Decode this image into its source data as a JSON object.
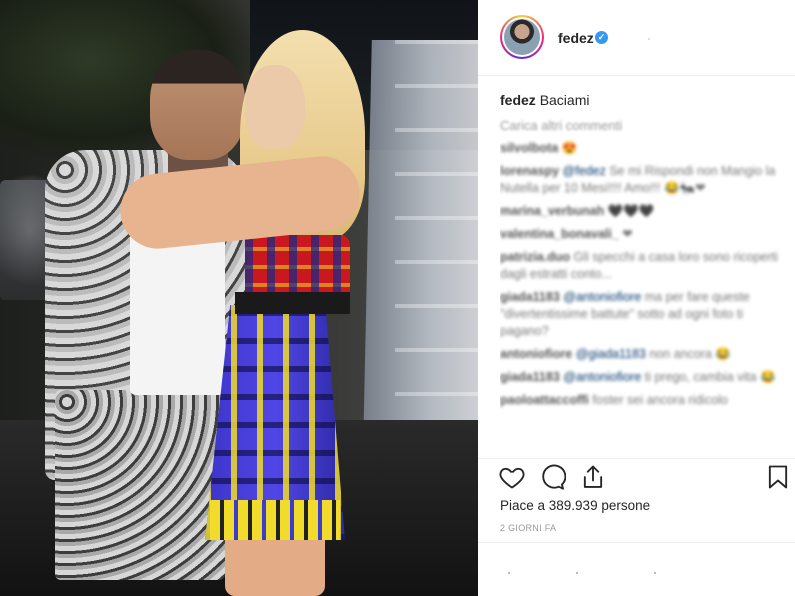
{
  "post": {
    "username": "fedez",
    "verified_mark": "✓",
    "caption_user": "fedez",
    "caption_text": "Baciami",
    "load_more": "Carica altri commenti",
    "likes_text": "Piace a 389.939 persone",
    "date": "2 GIORNI FA"
  },
  "comments": [
    {
      "user": "silvolbota",
      "text": "😍"
    },
    {
      "user": "lorenaspy",
      "mention": "@fedez",
      "text": "Se mi Rispondi non Mangio la Nutella per 10 Mesi!!!! Amo!!! 😂🐜❤"
    },
    {
      "user": "marina_verbunah",
      "text": "🖤🖤🖤"
    },
    {
      "user": "valentina_bonavali_",
      "text": "❤"
    },
    {
      "user": "patrizia.duo",
      "text": "Gli specchi a casa loro sono ricoperti dagli estratti conto..."
    },
    {
      "user": "giada1183",
      "mention": "@antoniofiore",
      "text": "ma per fare queste \"divertentissime battute\" sotto ad ogni foto ti pagano?"
    },
    {
      "user": "antoniofiore",
      "mention": "@giada1183",
      "text": "non ancora 😂"
    },
    {
      "user": "giada1183",
      "mention": "@antoniofiore",
      "text": "ti prego, cambia vita 😂"
    },
    {
      "user": "paoloattaccoffi",
      "text": "foster sei ancora ridicolo"
    }
  ],
  "icons": {
    "like": "heart-icon",
    "comment": "comment-icon",
    "share": "share-icon",
    "save": "bookmark-icon"
  },
  "colors": {
    "verified": "#3897f0",
    "text": "#262626",
    "muted": "#999999",
    "divider": "#efefef"
  }
}
